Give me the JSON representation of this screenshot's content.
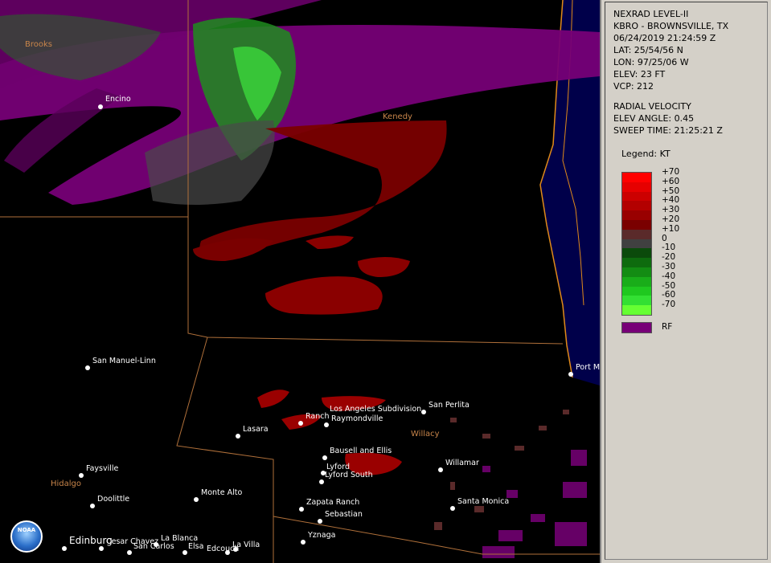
{
  "header": {
    "product": "NEXRAD LEVEL-II",
    "site": "KBRO - BROWNSVILLE, TX",
    "datetime": "06/24/2019 21:24:59 Z",
    "lat": "LAT: 25/54/56 N",
    "lon": "LON: 97/25/06 W",
    "elev": "ELEV: 23 FT",
    "vcp": "VCP: 212"
  },
  "velocity": {
    "type": "RADIAL VELOCITY",
    "elev_angle": "ELEV ANGLE: 0.45",
    "sweep_time": "SWEEP TIME: 21:25:21 Z"
  },
  "legend": {
    "title": "Legend: KT",
    "labels": [
      "+70",
      "+60",
      "+50",
      "+40",
      "+30",
      "+20",
      "+10",
      "0",
      "-10",
      "-20",
      "-30",
      "-40",
      "-50",
      "-60",
      "-70"
    ],
    "colors": [
      "#ff0000",
      "#e60000",
      "#cc0000",
      "#b30000",
      "#990000",
      "#7a0000",
      "#5a2a2a",
      "#404040",
      "#0b4a0b",
      "#0e6b0e",
      "#138c13",
      "#19ad19",
      "#1fc81f",
      "#33e033",
      "#66ff33"
    ],
    "rf_label": "RF",
    "rf_color": "#770077"
  },
  "counties": [
    {
      "name": "Brooks"
    },
    {
      "name": "Kenedy"
    },
    {
      "name": "Willacy"
    },
    {
      "name": "Hidalgo"
    }
  ],
  "cities": [
    {
      "name": "Encino"
    },
    {
      "name": "San Manuel-Linn"
    },
    {
      "name": "Port M"
    },
    {
      "name": "Los Angeles Subdivision"
    },
    {
      "name": "San Perlita"
    },
    {
      "name": "Ranch"
    },
    {
      "name": "Raymondville"
    },
    {
      "name": "Lasara"
    },
    {
      "name": "Bausell and Ellis"
    },
    {
      "name": "Willamar"
    },
    {
      "name": "Lyford"
    },
    {
      "name": "Lyford South"
    },
    {
      "name": "Faysville"
    },
    {
      "name": "Monte Alto"
    },
    {
      "name": "Doolittle"
    },
    {
      "name": "Zapata Ranch"
    },
    {
      "name": "Santa Monica"
    },
    {
      "name": "Sebastian"
    },
    {
      "name": "Yznaga"
    },
    {
      "name": "Edinburg"
    },
    {
      "name": "Cesar Chavez"
    },
    {
      "name": "La Blanca"
    },
    {
      "name": "San Carlos"
    },
    {
      "name": "Elsa"
    },
    {
      "name": "Edcouch"
    },
    {
      "name": "La Villa"
    }
  ],
  "logo": {
    "text": "NOAA"
  }
}
